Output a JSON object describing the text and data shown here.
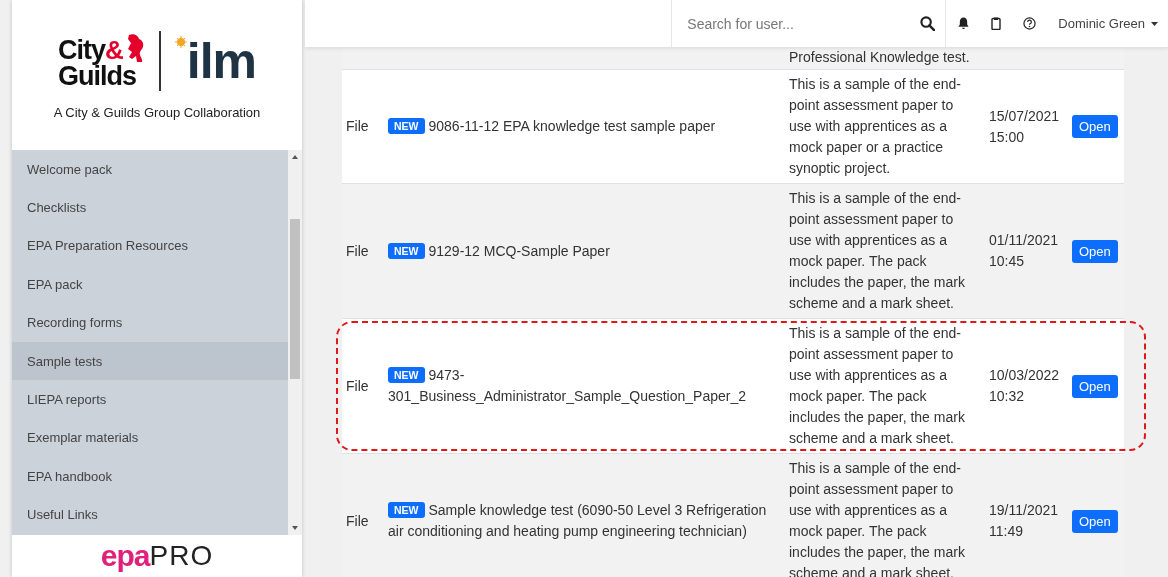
{
  "sidebar": {
    "logo": {
      "city": "City",
      "amp": "&",
      "guilds": "Guilds",
      "ilm": "ilm",
      "tagline": "A City & Guilds Group Collaboration"
    },
    "items": [
      {
        "label": "Welcome pack",
        "selected": false
      },
      {
        "label": "Checklists",
        "selected": false
      },
      {
        "label": "EPA Preparation Resources",
        "selected": false
      },
      {
        "label": "EPA pack",
        "selected": false
      },
      {
        "label": "Recording forms",
        "selected": false
      },
      {
        "label": "Sample tests",
        "selected": true
      },
      {
        "label": "LIEPA reports",
        "selected": false
      },
      {
        "label": "Exemplar materials",
        "selected": false
      },
      {
        "label": "EPA handbook",
        "selected": false
      },
      {
        "label": "Useful Links",
        "selected": false
      }
    ],
    "footer_logo": {
      "part_1": "epa",
      "part_2": "PRO"
    }
  },
  "header": {
    "search": {
      "placeholder": "Search for user..."
    },
    "user": "Dominic Green"
  },
  "table": {
    "partial_row": {
      "description": "Professional Knowledge test."
    },
    "rows": [
      {
        "type": "File",
        "badge": "NEW",
        "name": "9086-11-12 EPA knowledge test sample paper",
        "description": "This is a sample of the end-point assessment paper to use with apprentices as a mock paper or a practice synoptic project.",
        "date": "15/07/2021",
        "time": "15:00",
        "action": "Open",
        "highlighted": false
      },
      {
        "type": "File",
        "badge": "NEW",
        "name": "9129-12 MCQ-Sample Paper",
        "description": "This is a sample of the end-point assessment paper to use with apprentices as a mock paper. The pack includes the paper, the mark scheme and a mark sheet.",
        "date": "01/11/2021",
        "time": "10:45",
        "action": "Open",
        "highlighted": false
      },
      {
        "type": "File",
        "badge": "NEW",
        "name": "9473-301_Business_Administrator_Sample_Question_Paper_2",
        "description": "This is a sample of the end-point assessment paper to use with apprentices as a mock paper. The pack includes the paper, the mark scheme and a mark sheet.",
        "date": "10/03/2022",
        "time": "10:32",
        "action": "Open",
        "highlighted": true
      },
      {
        "type": "File",
        "badge": "NEW",
        "name": "Sample knowledge test (6090-50 Level 3 Refrigeration air conditioning and heating pump engineering technician)",
        "description": "This is a sample of the end-point assessment paper to use with apprentices as a mock paper. The pack includes the paper, the mark scheme and a mark sheet.",
        "date": "19/11/2021",
        "time": "11:49",
        "action": "Open",
        "highlighted": false
      }
    ]
  }
}
